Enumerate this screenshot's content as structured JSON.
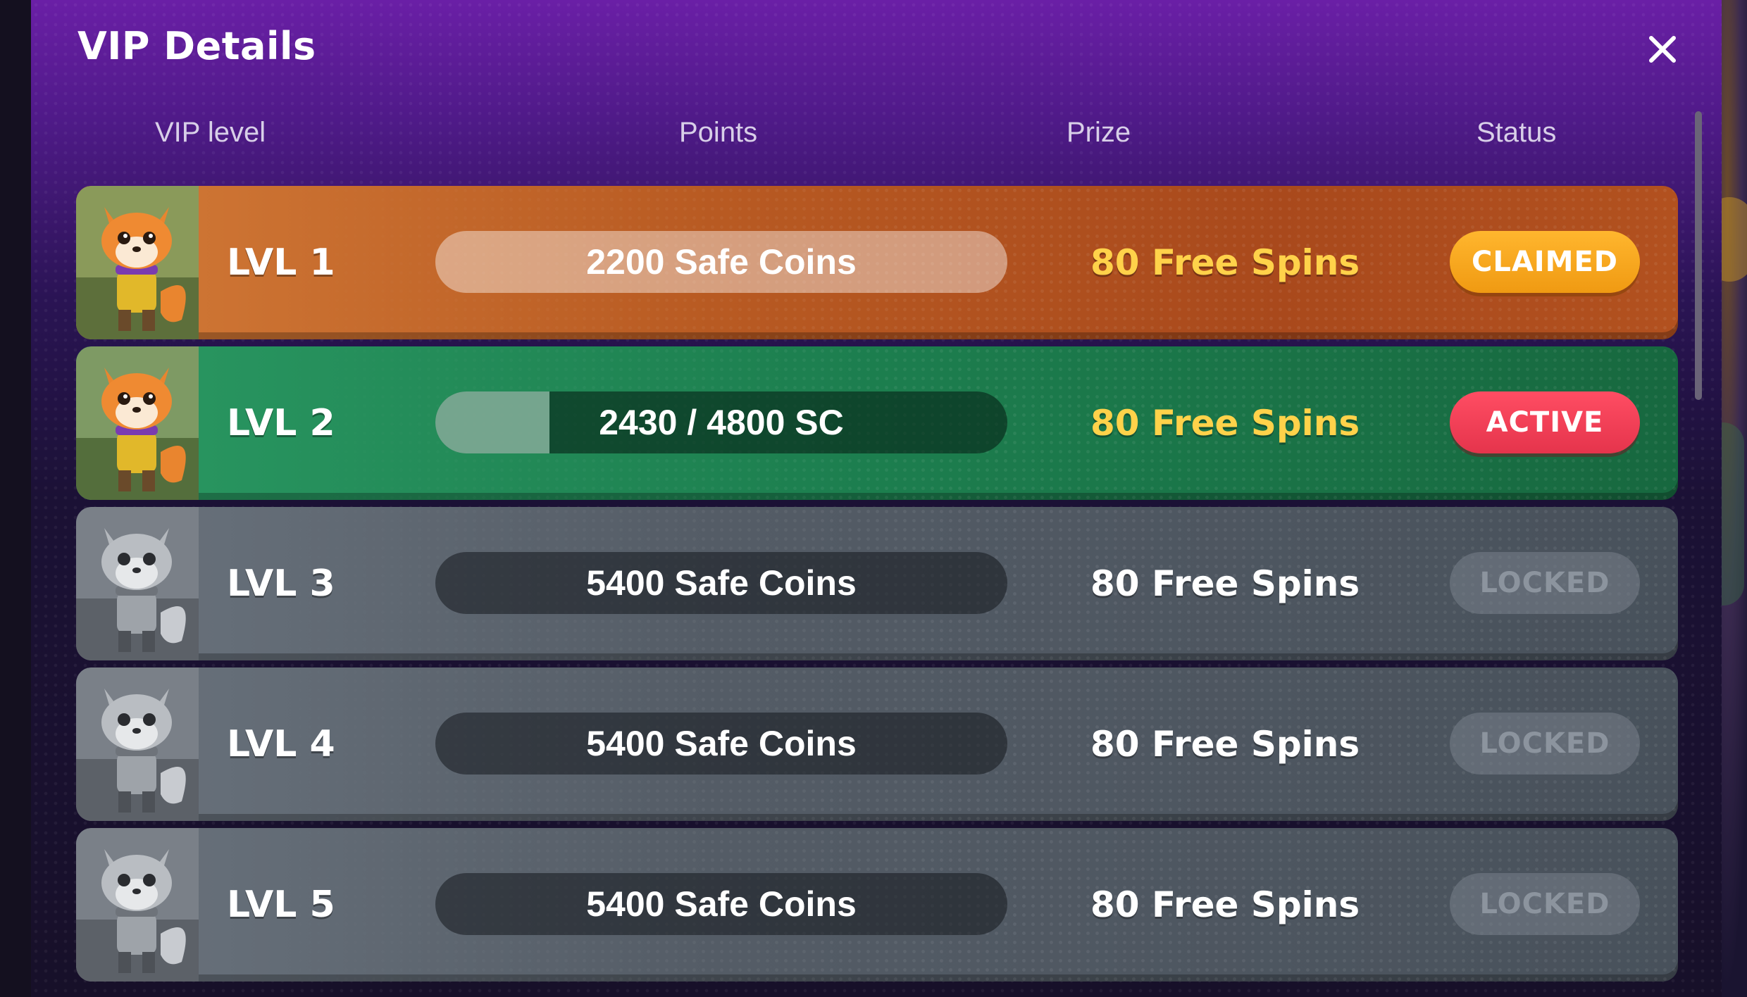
{
  "modal": {
    "title": "VIP Details",
    "close_icon": "close-icon"
  },
  "columns": {
    "level": "VIP level",
    "points": "Points",
    "prize": "Prize",
    "status": "Status"
  },
  "rows": [
    {
      "level": "LVL 1",
      "points": "2200 Safe Coins",
      "prize": "80 Free Spins",
      "status": "CLAIMED",
      "theme": "orange",
      "avatar": "fox-color-avatar"
    },
    {
      "level": "LVL 2",
      "points": "2430 / 4800 SC",
      "progress": 0.2,
      "prize": "80 Free Spins",
      "status": "ACTIVE",
      "theme": "green",
      "avatar": "fox-color-avatar"
    },
    {
      "level": "LVL 3",
      "points": "5400 Safe Coins",
      "prize": "80 Free Spins",
      "status": "LOCKED",
      "theme": "gray",
      "avatar": "fox-gray-avatar"
    },
    {
      "level": "LVL 4",
      "points": "5400 Safe Coins",
      "prize": "80 Free Spins",
      "status": "LOCKED",
      "theme": "gray",
      "avatar": "fox-gray-avatar"
    },
    {
      "level": "LVL 5",
      "points": "5400 Safe Coins",
      "prize": "80 Free Spins",
      "status": "LOCKED",
      "theme": "gray",
      "avatar": "fox-gray-avatar"
    }
  ],
  "colors": {
    "claimed": "#f5a51f",
    "active": "#ef3f56",
    "prize_gold": "#ffd24a",
    "modal_top": "#6a1fa6"
  }
}
